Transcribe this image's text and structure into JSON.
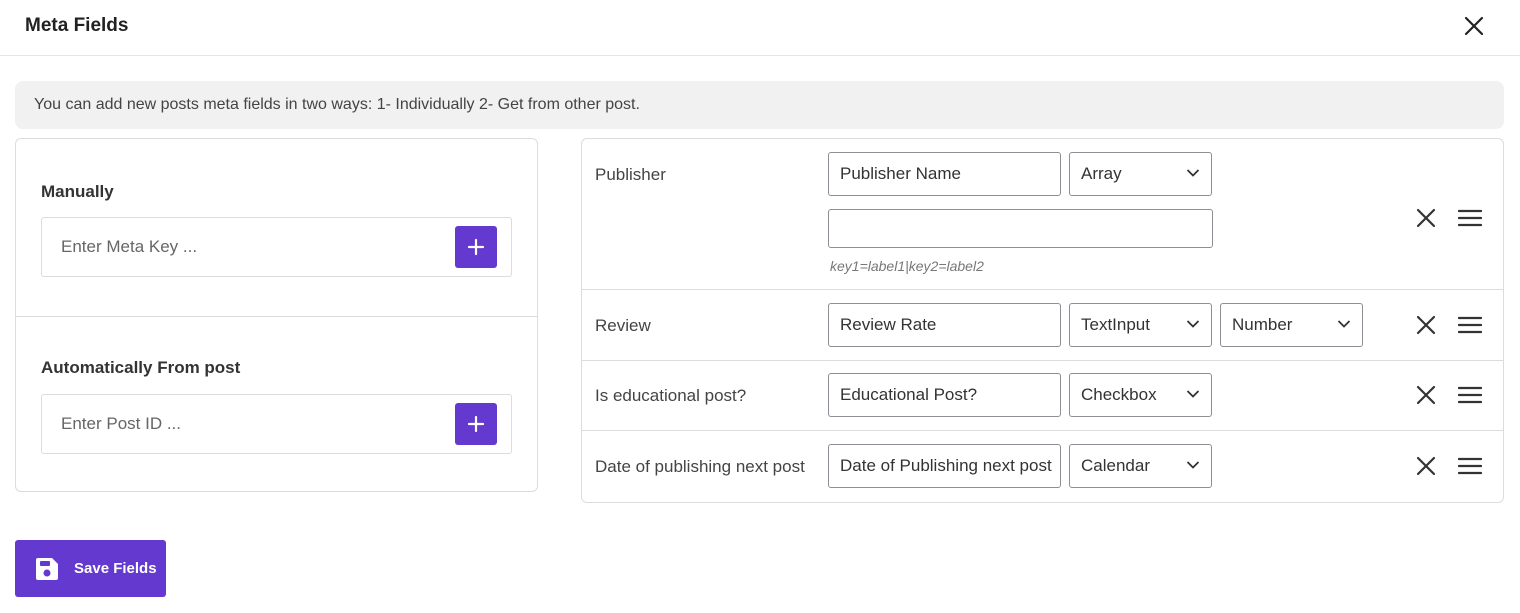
{
  "header": {
    "title": "Meta Fields"
  },
  "info_text": "You can add new posts meta fields in two ways: 1- Individually 2- Get from other post.",
  "manual": {
    "title": "Manually",
    "placeholder": "Enter Meta Key ..."
  },
  "automatic": {
    "title": "Automatically From post",
    "placeholder": "Enter Post ID ..."
  },
  "rows": [
    {
      "label": "Publisher",
      "name_value": "Publisher Name",
      "type": "Array",
      "options_value": "",
      "hint": "key1=label1|key2=label2"
    },
    {
      "label": "Review",
      "name_value": "Review Rate",
      "type": "TextInput",
      "subtype": "Number"
    },
    {
      "label": "Is educational post?",
      "name_value": "Educational Post?",
      "type": "Checkbox"
    },
    {
      "label": "Date of publishing next post",
      "name_value": "Date of Publishing next post",
      "type": "Calendar"
    }
  ],
  "save_button": {
    "label": "Save Fields"
  },
  "icons": {
    "close": "close-icon",
    "add": "plus-icon",
    "drag": "hamburger-icon",
    "save": "floppy-disk-icon",
    "dropdown": "chevron-down-icon"
  },
  "colors": {
    "accent": "#6439cf"
  }
}
